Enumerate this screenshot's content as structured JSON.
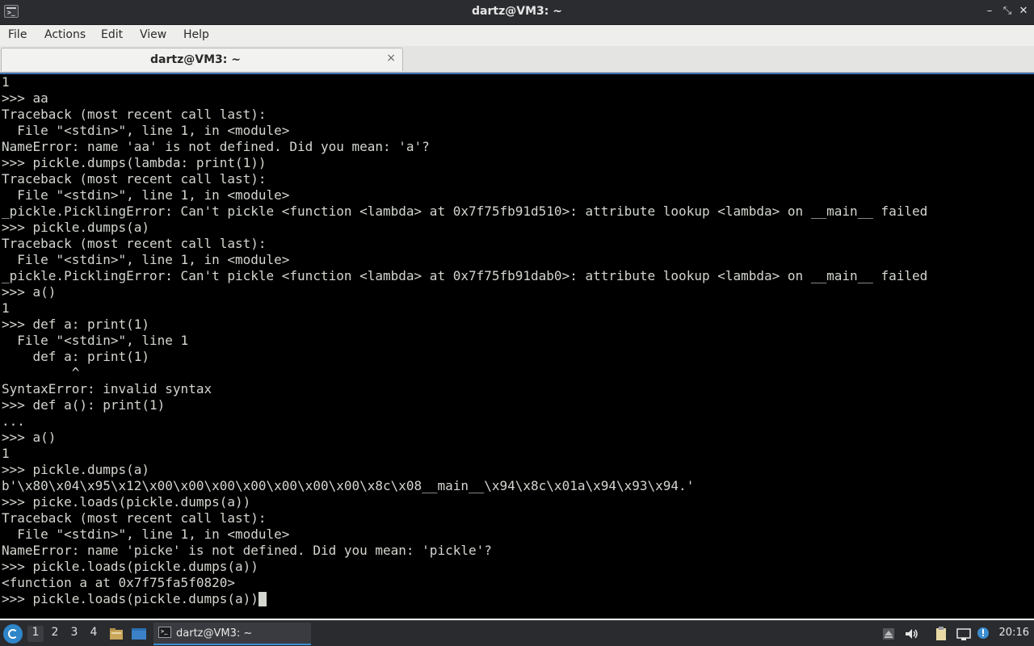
{
  "window": {
    "title": "dartz@VM3: ~"
  },
  "menubar": {
    "items": [
      "File",
      "Actions",
      "Edit",
      "View",
      "Help"
    ]
  },
  "tabs": [
    {
      "label": "dartz@VM3: ~",
      "close_icon": "×"
    }
  ],
  "terminal": {
    "lines": [
      "1",
      ">>> aa",
      "Traceback (most recent call last):",
      "  File \"<stdin>\", line 1, in <module>",
      "NameError: name 'aa' is not defined. Did you mean: 'a'?",
      ">>> pickle.dumps(lambda: print(1))",
      "Traceback (most recent call last):",
      "  File \"<stdin>\", line 1, in <module>",
      "_pickle.PicklingError: Can't pickle <function <lambda> at 0x7f75fb91d510>: attribute lookup <lambda> on __main__ failed",
      ">>> pickle.dumps(a)",
      "Traceback (most recent call last):",
      "  File \"<stdin>\", line 1, in <module>",
      "_pickle.PicklingError: Can't pickle <function <lambda> at 0x7f75fb91dab0>: attribute lookup <lambda> on __main__ failed",
      ">>> a()",
      "1",
      ">>> def a: print(1)",
      "  File \"<stdin>\", line 1",
      "    def a: print(1)",
      "         ^",
      "SyntaxError: invalid syntax",
      ">>> def a(): print(1)",
      "...",
      ">>> a()",
      "1",
      ">>> pickle.dumps(a)",
      "b'\\x80\\x04\\x95\\x12\\x00\\x00\\x00\\x00\\x00\\x00\\x00\\x8c\\x08__main__\\x94\\x8c\\x01a\\x94\\x93\\x94.'",
      ">>> picke.loads(pickle.dumps(a))",
      "Traceback (most recent call last):",
      "  File \"<stdin>\", line 1, in <module>",
      "NameError: name 'picke' is not defined. Did you mean: 'pickle'?",
      ">>> pickle.loads(pickle.dumps(a))",
      "<function a at 0x7f75fa5f0820>"
    ],
    "current_input": ">>> pickle.loads(pickle.dumps(a))"
  },
  "panel": {
    "workspaces": [
      "1",
      "2",
      "3",
      "4"
    ],
    "active_workspace": "1",
    "task_label": "dartz@VM3: ~",
    "clock": "20:16"
  },
  "colors": {
    "titlebar": "#2b2c30",
    "terminal_bg": "#000000",
    "terminal_fg": "#d3d7cf",
    "panel_bg": "#2a2b2e",
    "accent": "#3c8cd0"
  }
}
